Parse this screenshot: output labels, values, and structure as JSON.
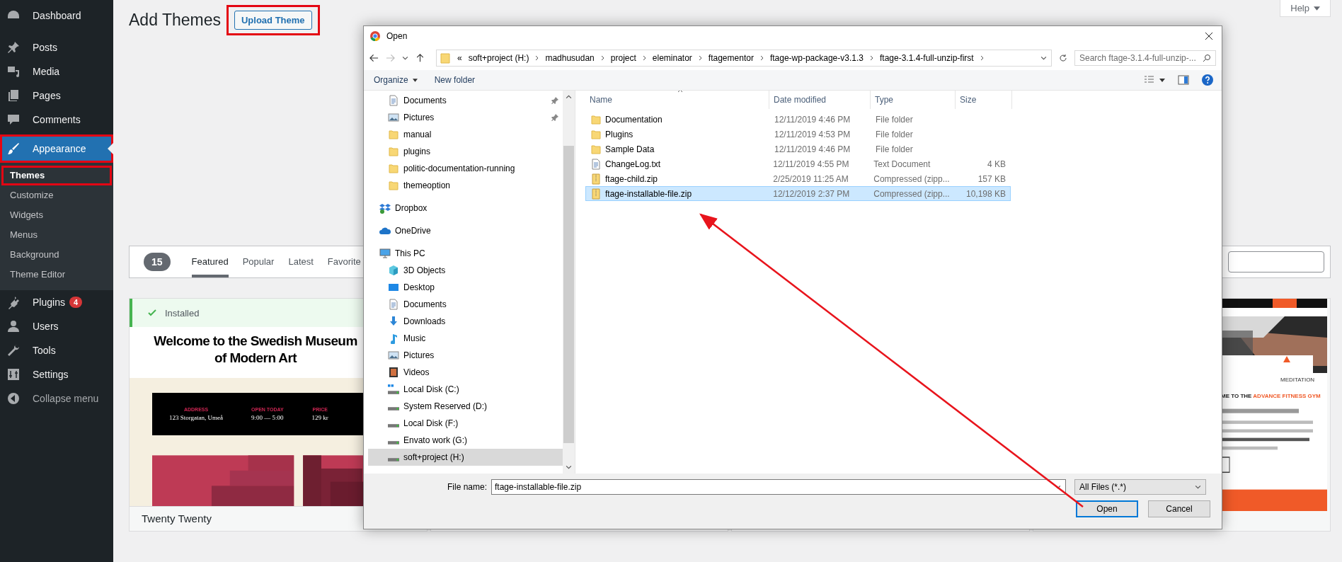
{
  "sidebar": {
    "items": [
      {
        "label": "Dashboard",
        "kind": "dashboard",
        "selected": false,
        "highlighted": false
      },
      {
        "label": "Posts",
        "kind": "pin",
        "selected": false,
        "highlighted": false
      },
      {
        "label": "Media",
        "kind": "media",
        "selected": false,
        "highlighted": false
      },
      {
        "label": "Pages",
        "kind": "pages",
        "selected": false,
        "highlighted": false
      },
      {
        "label": "Comments",
        "kind": "comment",
        "selected": false,
        "highlighted": false
      },
      {
        "label": "Appearance",
        "kind": "brush",
        "selected": true,
        "highlighted": true,
        "children": [
          {
            "label": "Themes",
            "selected": true,
            "highlighted": true
          },
          {
            "label": "Customize",
            "selected": false,
            "highlighted": false
          },
          {
            "label": "Widgets",
            "selected": false,
            "highlighted": false
          },
          {
            "label": "Menus",
            "selected": false,
            "highlighted": false
          },
          {
            "label": "Background",
            "selected": false,
            "highlighted": false
          },
          {
            "label": "Theme Editor",
            "selected": false,
            "highlighted": false
          }
        ]
      },
      {
        "label": "Plugins",
        "kind": "plug",
        "selected": false,
        "highlighted": false,
        "badge": "4"
      },
      {
        "label": "Users",
        "kind": "user",
        "selected": false,
        "highlighted": false
      },
      {
        "label": "Tools",
        "kind": "wrench",
        "selected": false,
        "highlighted": false
      },
      {
        "label": "Settings",
        "kind": "sliders",
        "selected": false,
        "highlighted": false
      },
      {
        "label": "Collapse menu",
        "kind": "collapse",
        "selected": false,
        "highlighted": false
      }
    ]
  },
  "help_tab": {
    "label": "Help"
  },
  "header": {
    "title": "Add Themes",
    "upload_button": {
      "label": "Upload Theme",
      "highlighted": true
    }
  },
  "filter_bar": {
    "count": "15",
    "tabs": [
      {
        "label": "Featured",
        "selected": true
      },
      {
        "label": "Popular",
        "selected": false
      },
      {
        "label": "Latest",
        "selected": false
      },
      {
        "label": "Favorite",
        "selected": false
      }
    ]
  },
  "themes": [
    {
      "kind": "museum",
      "notice": "Installed",
      "heading": "Welcome to the Swedish Museum of Modern Art",
      "facts": [
        {
          "label": "ADDRESS",
          "value": "123 Storgatan, Umeå"
        },
        {
          "label": "OPEN TODAY",
          "value": "9:00 — 5:00"
        },
        {
          "label": "PRICE",
          "value": "129 kr"
        }
      ],
      "name": "Twenty Twenty"
    },
    {
      "kind": "gym",
      "heading": "ME TO THE",
      "heading_accent": "ADVANCE FITNESS GYM",
      "feature": "MEDITATION"
    }
  ],
  "dialog": {
    "title": "Open",
    "path": {
      "overflow": "«",
      "segments": [
        "soft+project (H:)",
        "madhusudan",
        "project",
        "eleminator",
        "ftagementor",
        "ftage-wp-package-v3.1.3",
        "ftage-3.1.4-full-unzip-first"
      ]
    },
    "search": {
      "placeholder": "Search ftage-3.1.4-full-unzip-..."
    },
    "toolbar": {
      "organize": "Organize",
      "new_folder": "New folder"
    },
    "nav": [
      {
        "label": "Documents",
        "kind": "documents",
        "pinned": true,
        "selected": false
      },
      {
        "label": "Pictures",
        "kind": "pictures",
        "pinned": true,
        "selected": false
      },
      {
        "label": "manual",
        "kind": "folder",
        "pinned": false,
        "selected": false
      },
      {
        "label": "plugins",
        "kind": "folder",
        "pinned": false,
        "selected": false
      },
      {
        "label": "politic-documentation-running",
        "kind": "folder",
        "pinned": false,
        "selected": false
      },
      {
        "label": "themeoption",
        "kind": "folder",
        "pinned": false,
        "selected": false
      },
      {
        "label": "Dropbox",
        "kind": "dropbox",
        "group": true,
        "selected": false
      },
      {
        "label": "OneDrive",
        "kind": "onedrive",
        "group": true,
        "selected": false
      },
      {
        "label": "This PC",
        "kind": "pc",
        "group": true,
        "selected": false,
        "children": [
          {
            "label": "3D Objects",
            "kind": "cube",
            "selected": false
          },
          {
            "label": "Desktop",
            "kind": "desktop",
            "selected": false
          },
          {
            "label": "Documents",
            "kind": "documents",
            "selected": false
          },
          {
            "label": "Downloads",
            "kind": "downloads",
            "selected": false
          },
          {
            "label": "Music",
            "kind": "music",
            "selected": false
          },
          {
            "label": "Pictures",
            "kind": "pictures",
            "selected": false
          },
          {
            "label": "Videos",
            "kind": "videos",
            "selected": false
          },
          {
            "label": "Local Disk (C:)",
            "kind": "sysdisk",
            "selected": false
          },
          {
            "label": "System Reserved (D:)",
            "kind": "disk",
            "selected": false
          },
          {
            "label": "Local Disk (F:)",
            "kind": "disk",
            "selected": false
          },
          {
            "label": "Envato work (G:)",
            "kind": "disk",
            "selected": false
          },
          {
            "label": "soft+project (H:)",
            "kind": "disk",
            "selected": true
          }
        ]
      }
    ],
    "columns": [
      {
        "label": "Name",
        "sorted": true
      },
      {
        "label": "Date modified",
        "sorted": false
      },
      {
        "label": "Type",
        "sorted": false
      },
      {
        "label": "Size",
        "sorted": false
      }
    ],
    "files": [
      {
        "name": "Documentation",
        "date": "12/11/2019 4:46 PM",
        "type": "File folder",
        "kind": "folder",
        "selected": false
      },
      {
        "name": "Plugins",
        "date": "12/11/2019 4:53 PM",
        "type": "File folder",
        "kind": "folder",
        "selected": false
      },
      {
        "name": "Sample Data",
        "date": "12/11/2019 4:46 PM",
        "type": "File folder",
        "kind": "folder",
        "selected": false
      },
      {
        "name": "ChangeLog.txt",
        "date": "12/11/2019 4:55 PM",
        "type": "Text Document",
        "size": "4 KB",
        "kind": "text",
        "selected": false
      },
      {
        "name": "ftage-child.zip",
        "date": "2/25/2019 11:25 AM",
        "type": "Compressed (zipp...",
        "size": "157 KB",
        "kind": "zip",
        "selected": false
      },
      {
        "name": "ftage-installable-file.zip",
        "date": "12/12/2019 2:37 PM",
        "type": "Compressed (zipp...",
        "size": "10,198 KB",
        "kind": "zip",
        "selected": true
      }
    ],
    "file_name": {
      "label": "File name:",
      "value": "ftage-installable-file.zip"
    },
    "filter": {
      "value": "All Files (*.*)"
    },
    "buttons": [
      {
        "label": "Open",
        "default": true
      },
      {
        "label": "Cancel",
        "default": false
      }
    ]
  }
}
